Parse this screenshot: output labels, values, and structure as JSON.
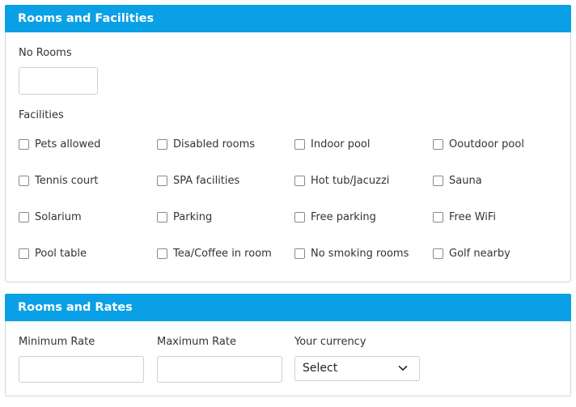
{
  "rooms_facilities": {
    "title": "Rooms and Facilities",
    "no_rooms_label": "No Rooms",
    "no_rooms_value": "",
    "facilities_label": "Facilities",
    "facilities": [
      [
        "Pets allowed",
        "Disabled rooms",
        "Indoor pool",
        "Ooutdoor pool"
      ],
      [
        "Tennis court",
        "SPA facilities",
        "Hot tub/Jacuzzi",
        "Sauna"
      ],
      [
        "Solarium",
        "Parking",
        "Free parking",
        "Free WiFi"
      ],
      [
        "Pool table",
        "Tea/Coffee in room",
        "No smoking rooms",
        "Golf nearby"
      ]
    ]
  },
  "rooms_rates": {
    "title": "Rooms and Rates",
    "min_rate_label": "Minimum Rate",
    "min_rate_value": "",
    "max_rate_label": "Maximum Rate",
    "max_rate_value": "",
    "currency_label": "Your currency",
    "currency_selected": "Select"
  },
  "colors": {
    "header_bg": "#0aa0e6",
    "header_text": "#ffffff",
    "border": "#d6d6d6"
  },
  "icons": {
    "select_arrow": "chevron-down-icon"
  }
}
